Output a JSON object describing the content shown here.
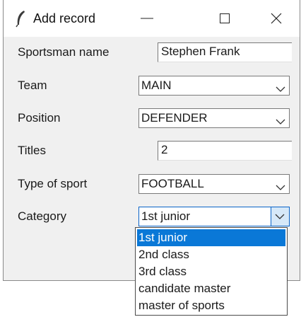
{
  "window": {
    "title": "Add record",
    "app_icon": "feather-icon",
    "controls": [
      "minimize-icon",
      "maximize-icon",
      "close-icon"
    ]
  },
  "form": {
    "sportsman_name": {
      "label": "Sportsman name",
      "value": "Stephen Frank"
    },
    "team": {
      "label": "Team",
      "value": "MAIN"
    },
    "position": {
      "label": "Position",
      "value": "DEFENDER"
    },
    "titles": {
      "label": "Titles",
      "value": "2"
    },
    "type_of_sport": {
      "label": "Type of sport",
      "value": "FOOTBALL"
    },
    "category": {
      "label": "Category",
      "value": "1st junior",
      "options": [
        "1st junior",
        "2nd class",
        "3rd class",
        "candidate master",
        "master of sports"
      ],
      "highlighted": "1st junior"
    }
  },
  "colors": {
    "selection": "#0a78d7",
    "focus_border": "#0a64c8",
    "dialog_bg": "#f0f0f0"
  }
}
